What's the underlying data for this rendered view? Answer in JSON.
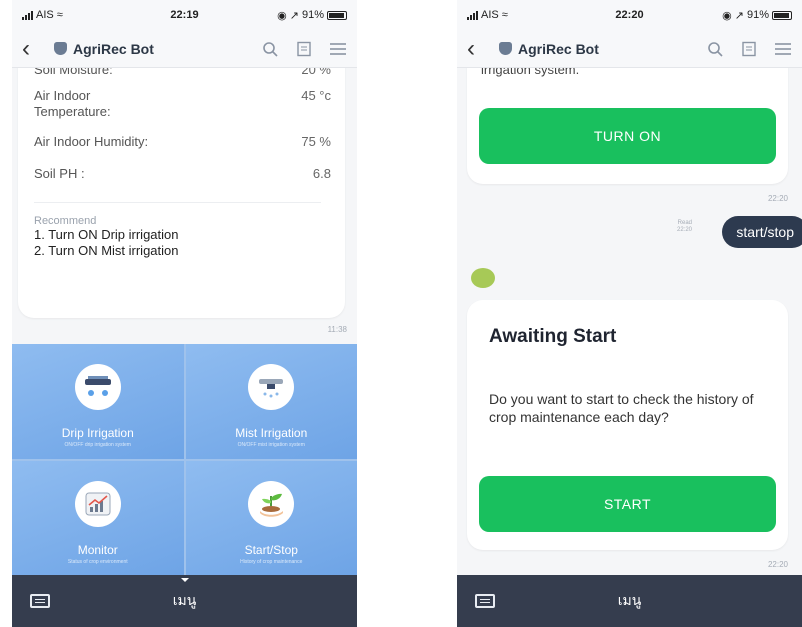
{
  "left": {
    "status": {
      "carrier": "AIS",
      "time": "22:19",
      "battery": "91%",
      "battery_level": 0.91
    },
    "nav": {
      "title": "AgriRec Bot"
    },
    "sensor_card": {
      "partial_row": {
        "label": "Soil Moisture:",
        "value": "20 %"
      },
      "rows": [
        {
          "label": "Air Indoor\nTemperature:",
          "value": "45 °c"
        },
        {
          "label": "Air Indoor Humidity:",
          "value": "75 %"
        },
        {
          "label": "Soil PH :",
          "value": "6.8"
        }
      ],
      "recommend_title": "Recommend",
      "recommend_lines": [
        "1. Turn ON  Drip irrigation",
        "2. Turn ON Mist irrigation"
      ]
    },
    "card_time": "11:38",
    "rich_menu": [
      {
        "name": "Drip Irrigation",
        "desc": "ON/OFF drip irrigation system",
        "icon": "drip-irrigation-icon"
      },
      {
        "name": "Mist Irrigation",
        "desc": "ON/OFF mist irrigation system",
        "icon": "mist-irrigation-icon"
      },
      {
        "name": "Monitor",
        "desc": "Status of crop environment",
        "icon": "monitor-chart-icon"
      },
      {
        "name": "Start/Stop",
        "desc": "History of crop maintenance",
        "icon": "sprout-hand-icon"
      }
    ],
    "menu_label": "เมนู"
  },
  "right": {
    "status": {
      "carrier": "AIS",
      "time": "22:20",
      "battery": "91%",
      "battery_level": 0.91
    },
    "nav": {
      "title": "AgriRec Bot"
    },
    "partial_text": "irrigation system.",
    "turn_on_button": "TURN ON",
    "turn_on_time": "22:20",
    "user_message": "start/stop",
    "read_label": "Read",
    "read_time": "22:20",
    "awaiting_title": "Awaiting Start",
    "awaiting_body": "Do you want to start to check the history of crop maintenance each day?",
    "start_button": "START",
    "start_time": "22:20",
    "menu_label": "เมนู"
  },
  "colors": {
    "green": "#19c05e",
    "navy": "#353d4e",
    "menu_blue": "#7ab0ec",
    "bubble": "#2d3a4f"
  }
}
